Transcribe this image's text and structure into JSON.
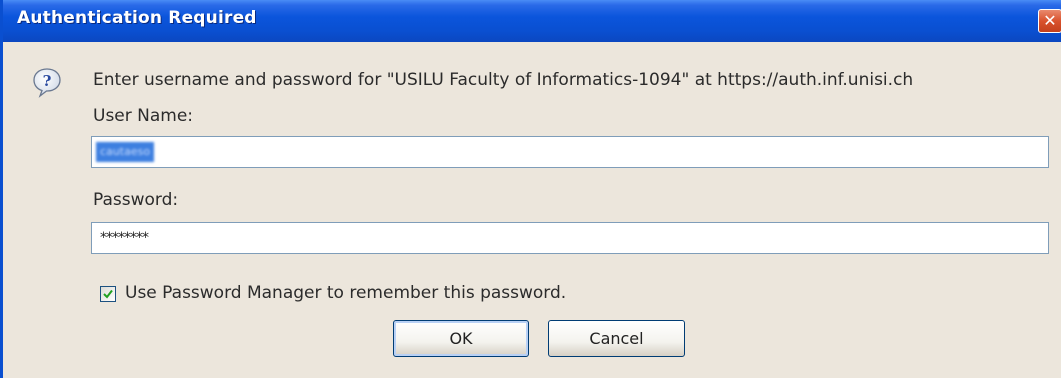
{
  "window": {
    "title": "Authentication Required",
    "close_glyph": "✕"
  },
  "dialog": {
    "icon": "help-question-icon",
    "prompt": "Enter username and password for \"USILU Faculty of Informatics-1094\" at https://auth.inf.unisi.ch",
    "username_label": "User Name:",
    "username_value": "cautaeso",
    "password_label": "Password:",
    "password_value": "********",
    "remember_label": "Use Password Manager to remember this password.",
    "remember_checked": true
  },
  "buttons": {
    "ok_label": "OK",
    "cancel_label": "Cancel"
  },
  "colors": {
    "titlebar": "#0a4fd0",
    "dialog_bg": "#ece6dc",
    "selection": "#3d7fe0",
    "close_button": "#d9522d"
  }
}
